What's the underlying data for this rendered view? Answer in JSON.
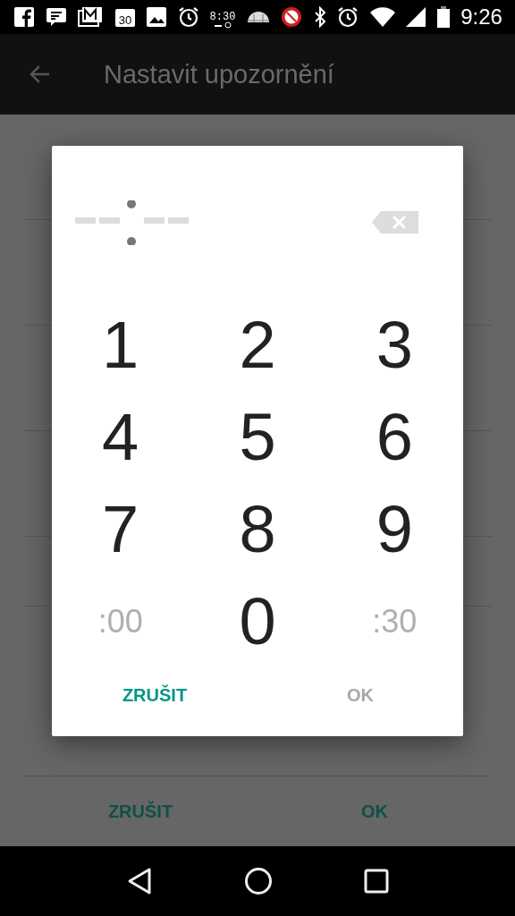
{
  "status_bar": {
    "calendar_day": "30",
    "widget_time": "8:30",
    "time": "9:26"
  },
  "app_bar": {
    "title": "Nastavit upozornění"
  },
  "actions": [
    {
      "label": "ZRUŠIT"
    },
    {
      "label": "OK"
    }
  ],
  "dialog": {
    "backspace_disabled": true,
    "keys": [
      {
        "kind": "digit",
        "label": "1",
        "disabled": false
      },
      {
        "kind": "digit",
        "label": "2",
        "disabled": false
      },
      {
        "kind": "digit",
        "label": "3",
        "disabled": false
      },
      {
        "kind": "digit",
        "label": "4",
        "disabled": false
      },
      {
        "kind": "digit",
        "label": "5",
        "disabled": false
      },
      {
        "kind": "digit",
        "label": "6",
        "disabled": false
      },
      {
        "kind": "digit",
        "label": "7",
        "disabled": false
      },
      {
        "kind": "digit",
        "label": "8",
        "disabled": false
      },
      {
        "kind": "digit",
        "label": "9",
        "disabled": false
      },
      {
        "kind": "preset",
        "label": ":00",
        "disabled": true
      },
      {
        "kind": "digit",
        "label": "0",
        "disabled": false
      },
      {
        "kind": "preset",
        "label": ":30",
        "disabled": true
      }
    ],
    "buttons": [
      {
        "label": "ZRUŠIT",
        "disabled": false
      },
      {
        "label": "OK",
        "disabled": true
      }
    ]
  }
}
